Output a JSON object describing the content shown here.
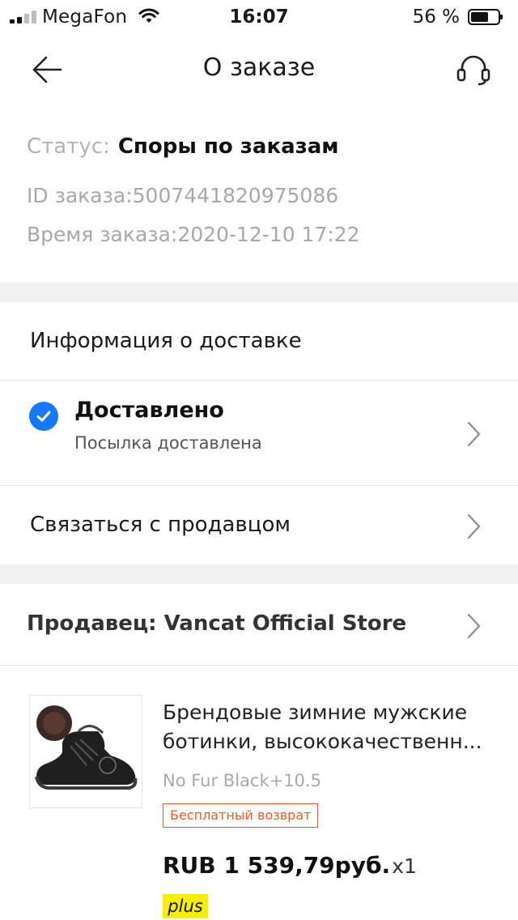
{
  "status_bar": {
    "carrier": "MegaFon",
    "time": "16:07",
    "battery_percent": "56 %"
  },
  "nav": {
    "title": "О заказе",
    "back_icon": "arrow-left-icon",
    "support_icon": "headset-icon"
  },
  "order": {
    "status_label": "Статус:",
    "status_value": "Споры по заказам",
    "id_line": "ID заказа:5007441820975086",
    "time_line": "Время заказа:2020-12-10 17:22"
  },
  "delivery": {
    "section_title": "Информация о доставке",
    "status_title": "Доставлено",
    "status_subtitle": "Посылка доставлена",
    "status_icon": "check-circle-icon",
    "accent_color": "#1677ff"
  },
  "contact": {
    "label": "Связаться с продавцом"
  },
  "seller": {
    "label": "Продавец: Vancat Official Store"
  },
  "product": {
    "title_line1": "Брендовые зимние мужские",
    "title_line2": "ботинки, высококачественн...",
    "variant": "No Fur Black+10.5",
    "free_return": "Бесплатный возврат",
    "price": "RUB 1 539,79руб.",
    "quantity": "x1",
    "plus_badge": "plus",
    "badge_color": "#f05a22"
  }
}
